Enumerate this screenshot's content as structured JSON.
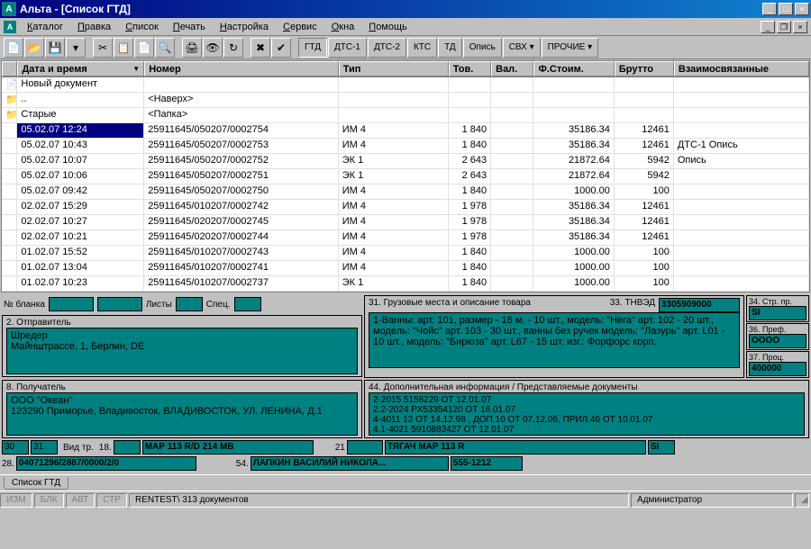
{
  "title": "Альта - [Список ГТД]",
  "menu": [
    "Каталог",
    "Правка",
    "Список",
    "Печать",
    "Настройка",
    "Сервис",
    "Окна",
    "Помощь"
  ],
  "toolTextButtons": [
    {
      "label": "ГТД",
      "active": true
    },
    {
      "label": "ДТС-1"
    },
    {
      "label": "ДТС-2"
    },
    {
      "label": "КТС"
    },
    {
      "label": "ТД"
    },
    {
      "label": "Опись"
    },
    {
      "label": "СВХ ▾"
    },
    {
      "label": "ПРОЧИЕ ▾"
    }
  ],
  "columns": [
    "",
    "Дата и время",
    "Номер",
    "Тип",
    "Тов.",
    "Вал.",
    "Ф.Стоим.",
    "Брутто",
    "Взаимосвязанные"
  ],
  "newDoc": "Новый документ",
  "upRow": {
    "name": "..",
    "num": "<Наверх>"
  },
  "folderRow": {
    "name": "Старые",
    "num": "<Папка>"
  },
  "rows": [
    {
      "dt": "05.02.07 12:24",
      "num": "25911645/050207/0002754",
      "type": "ИМ 4",
      "tov": "1 840",
      "fs": "35186.34",
      "br": "12461",
      "rel": "",
      "sel": true
    },
    {
      "dt": "05.02.07 10:43",
      "num": "25911645/050207/0002753",
      "type": "ИМ 4",
      "tov": "1 840",
      "fs": "35186.34",
      "br": "12461",
      "rel": "ДТС-1 Опись"
    },
    {
      "dt": "05.02.07 10:07",
      "num": "25911645/050207/0002752",
      "type": "ЭК 1",
      "tov": "2 643",
      "fs": "21872.64",
      "br": "5942",
      "rel": "Опись"
    },
    {
      "dt": "05.02.07 10:06",
      "num": "25911645/050207/0002751",
      "type": "ЭК 1",
      "tov": "2 643",
      "fs": "21872.64",
      "br": "5942",
      "rel": ""
    },
    {
      "dt": "05.02.07 09:42",
      "num": "25911645/050207/0002750",
      "type": "ИМ 4",
      "tov": "1 840",
      "fs": "1000.00",
      "br": "100",
      "rel": ""
    },
    {
      "dt": "02.02.07 15:29",
      "num": "25911645/010207/0002742",
      "type": "ИМ 4",
      "tov": "1 978",
      "fs": "35186.34",
      "br": "12461",
      "rel": ""
    },
    {
      "dt": "02.02.07 10:27",
      "num": "25911645/020207/0002745",
      "type": "ИМ 4",
      "tov": "1 978",
      "fs": "35186.34",
      "br": "12461",
      "rel": ""
    },
    {
      "dt": "02.02.07 10:21",
      "num": "25911645/020207/0002744",
      "type": "ИМ 4",
      "tov": "1 978",
      "fs": "35186.34",
      "br": "12461",
      "rel": ""
    },
    {
      "dt": "01.02.07 15:52",
      "num": "25911645/010207/0002743",
      "type": "ИМ 4",
      "tov": "1 840",
      "fs": "1000.00",
      "br": "100",
      "rel": ""
    },
    {
      "dt": "01.02.07 13:04",
      "num": "25911645/010207/0002741",
      "type": "ИМ 4",
      "tov": "1 840",
      "fs": "1000.00",
      "br": "100",
      "rel": ""
    },
    {
      "dt": "01.02.07 10:23",
      "num": "25911645/010207/0002737",
      "type": "ЭК 1",
      "tov": "1 840",
      "fs": "1000.00",
      "br": "100",
      "rel": ""
    }
  ],
  "fields": {
    "blankLabel": "№ бланка",
    "sheetsLabel": "Листы",
    "specLabel": "Спец.",
    "f2label": "2. Отправитель",
    "f2text": "Шредер\nМайнштрассе, 1, Берлин, DE",
    "f8label": "8. Получатель",
    "f8text": "ООО \"Океан\"\n123290 Приморье, Владивосток, ВЛАДИВОСТОК, УЛ. ЛЕНИНА, Д.1",
    "f31label": "31. Грузовые места и описание товара",
    "f31text": "1-Ванны: арт. 101, размер - 16 м, - 10 шт., модель: \"Нега\" арт. 102 - 20 шт., модель: \"Чойс\" арт. 103 - 30 шт., ванны без ручек модель: \"Лазурь\" арт. L01 - 10 шт., модель: \"Бирюза\" арт. L67 - 15 шт. изг.: Форфорс корп.",
    "f33label": "33. ТНВЭД",
    "f33val": "3305909000",
    "f34label": "34. Стр. пр.",
    "f34val": "SI",
    "f36label": "36. Преф.",
    "f36val": "ОООО",
    "f37label": "37. Проц.",
    "f37val": "400000",
    "f44label": "44. Дополнительная информация / Представляемые документы",
    "f44text": "2-2015 5158229 ОТ 12.01.07\n2.2-2024 РХ53354120 ОТ 16.01.07\n4-4011 12 ОТ 14.12.98 , ДОП.10 ОТ 07.12.06, ПРИЛ.46 ОТ 10.01.07\n4.1-4021 5910883427 ОТ 12.01.07",
    "v30": "30",
    "v31": "31",
    "vidLabel": "Вид тр.",
    "v18": "18.",
    "v18val": "МАР 113 R/D 214 МВ",
    "v21": "21",
    "v21val": "ТЯГАЧ МАР 113 R",
    "vSI": "SI",
    "v28": "28.",
    "v28val": "04071296/2887/0000/2/0",
    "v54": "54.",
    "v54val": "ЛАПКИН ВАСИЛИЙ НИКОЛА...",
    "v54ph": "555-1212"
  },
  "tab": "Список ГТД",
  "status": {
    "segs": [
      "ИЗМ",
      "БЛК",
      "АВТ",
      "СТР"
    ],
    "info": "RENTEST\\  313 документов",
    "user": "Администратор"
  }
}
